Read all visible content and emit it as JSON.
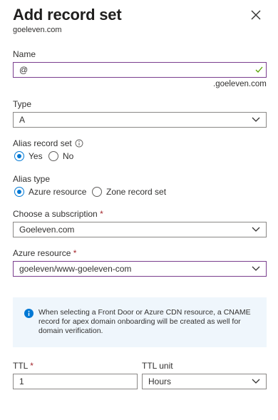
{
  "header": {
    "title": "Add record set",
    "subtitle": "goeleven.com"
  },
  "name_field": {
    "label": "Name",
    "value": "@",
    "suffix": ".goeleven.com"
  },
  "type_field": {
    "label": "Type",
    "value": "A"
  },
  "alias_record_set": {
    "label": "Alias record set",
    "options": [
      "Yes",
      "No"
    ],
    "selected": "Yes"
  },
  "alias_type": {
    "label": "Alias type",
    "options": [
      "Azure resource",
      "Zone record set"
    ],
    "selected": "Azure resource"
  },
  "subscription": {
    "label": "Choose a subscription",
    "required_mark": "*",
    "value": "Goeleven.com"
  },
  "azure_resource": {
    "label": "Azure resource",
    "required_mark": "*",
    "value": "goeleven/www-goeleven-com"
  },
  "info": {
    "text": "When selecting a Front Door or Azure CDN resource, a CNAME record for apex domain onboarding will be created as well for domain verification."
  },
  "ttl": {
    "label": "TTL",
    "required_mark": "*",
    "value": "1"
  },
  "ttl_unit": {
    "label": "TTL unit",
    "value": "Hours"
  },
  "colors": {
    "accent": "#0078d4",
    "active_border": "#7a3e8e",
    "valid_check": "#57a300",
    "required": "#a4262c",
    "info_bg": "#eff6fc"
  }
}
